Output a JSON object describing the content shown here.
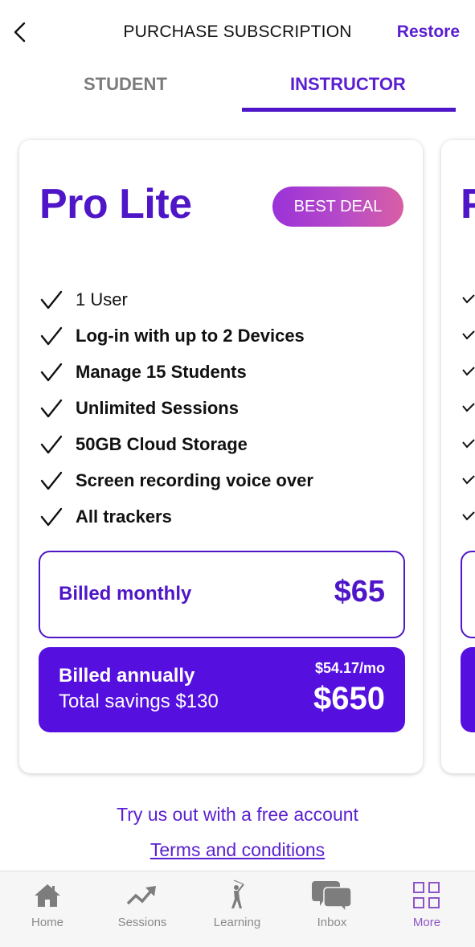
{
  "header": {
    "back_icon": "chevron-left-icon",
    "title": "PURCHASE SUBSCRIPTION",
    "restore_label": "Restore"
  },
  "tabs": [
    {
      "label": "STUDENT",
      "active": false
    },
    {
      "label": "INSTRUCTOR",
      "active": true
    }
  ],
  "plan": {
    "name": "Pro Lite",
    "badge": "BEST DEAL",
    "features": [
      "1 User",
      "Log-in with up to 2 Devices",
      "Manage 15 Students",
      "Unlimited Sessions",
      "50GB Cloud Storage",
      "Screen recording voice over",
      "All trackers"
    ],
    "monthly": {
      "label": "Billed monthly",
      "price": "$65"
    },
    "annual": {
      "label": "Billed annually",
      "savings": "Total savings $130",
      "per_month": "$54.17/mo",
      "price": "$650"
    }
  },
  "next_plan": {
    "name_partial": "P"
  },
  "footer_links": {
    "free_account": "Try us out with a free account",
    "terms": "Terms and conditions"
  },
  "bottom_nav": [
    {
      "label": "Home",
      "icon": "home-icon",
      "active": false
    },
    {
      "label": "Sessions",
      "icon": "trending-up-icon",
      "active": false
    },
    {
      "label": "Learning",
      "icon": "golfer-icon",
      "active": false
    },
    {
      "label": "Inbox",
      "icon": "chat-bubbles-icon",
      "active": false
    },
    {
      "label": "More",
      "icon": "grid-icon",
      "active": true
    }
  ],
  "colors": {
    "accent": "#4f16c8",
    "annual_bg": "#5510e0",
    "badge_gradient_start": "#9a32d8",
    "badge_gradient_end": "#d85fa4",
    "nav_inactive": "#8a8a8a",
    "nav_active": "#8e55c8"
  }
}
